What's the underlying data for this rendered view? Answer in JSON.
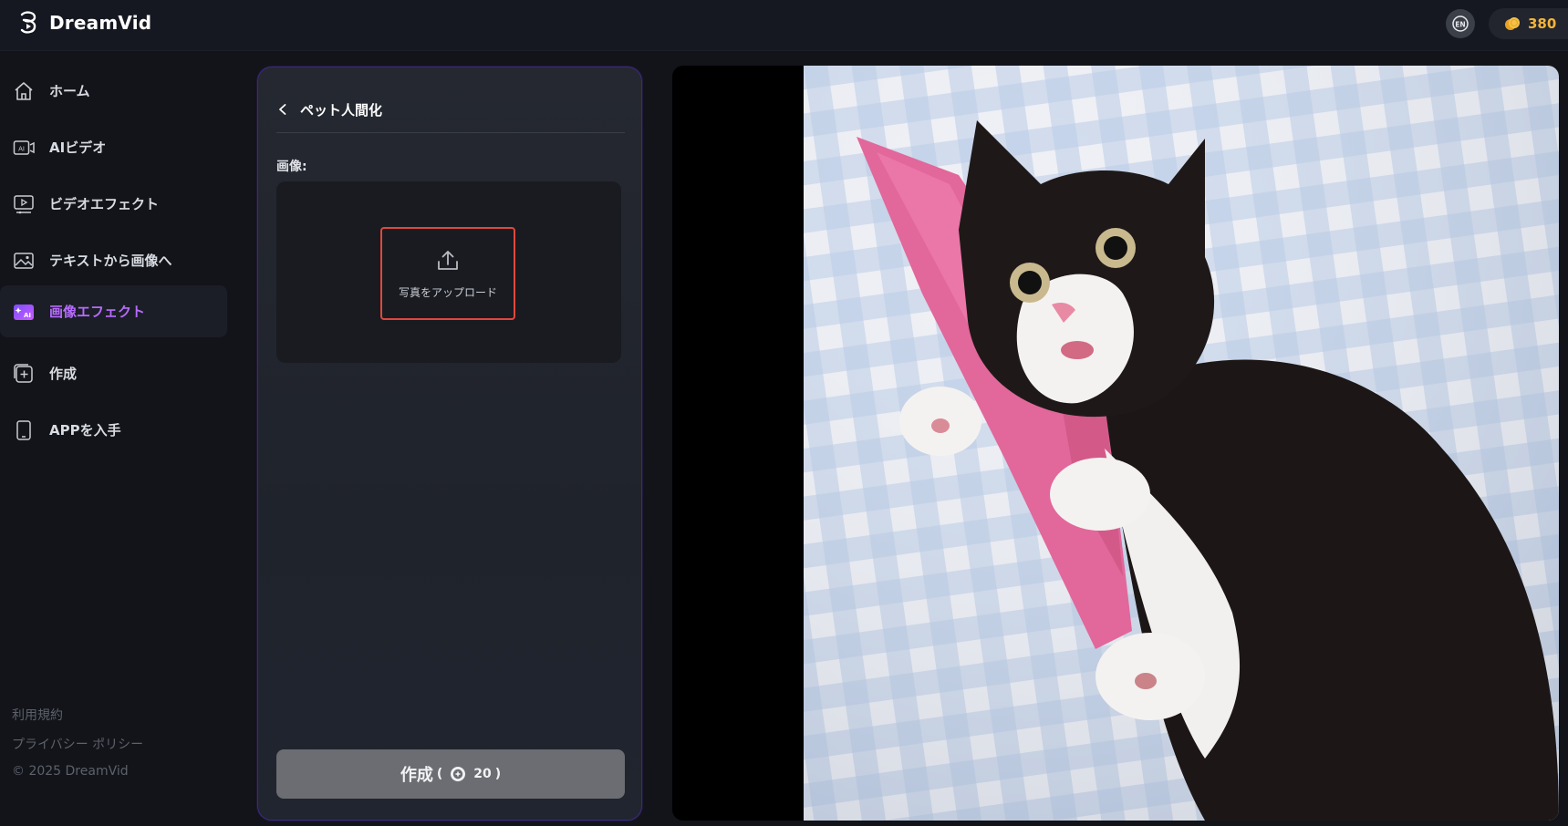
{
  "app": {
    "name": "DreamVid"
  },
  "header": {
    "language_badge": "EN",
    "credits": "380"
  },
  "sidebar": {
    "items": [
      {
        "label": "ホーム",
        "icon": "home-icon"
      },
      {
        "label": "AIビデオ",
        "icon": "ai-video-icon"
      },
      {
        "label": "ビデオエフェクト",
        "icon": "video-effect-icon"
      },
      {
        "label": "テキストから画像へ",
        "icon": "text-to-image-icon"
      },
      {
        "label": "画像エフェクト",
        "icon": "image-effect-icon",
        "active": true
      },
      {
        "label": "作成",
        "icon": "create-icon"
      },
      {
        "label": "APPを入手",
        "icon": "phone-icon"
      }
    ],
    "footer": {
      "terms": "利用規約",
      "privacy": "プライバシー ポリシー",
      "copyright": "© 2025 DreamVid"
    }
  },
  "panel": {
    "title": "ペット人間化",
    "image_label": "画像:",
    "upload_label": "写真をアップロード",
    "create_label": "作成",
    "create_paren_open": "(",
    "create_cost": "20",
    "create_paren_close": ")"
  },
  "colors": {
    "accent": "#b76bff",
    "credits": "#f4b33a",
    "upload_border": "#e0483d",
    "panel_border": "#3b2a7a"
  }
}
